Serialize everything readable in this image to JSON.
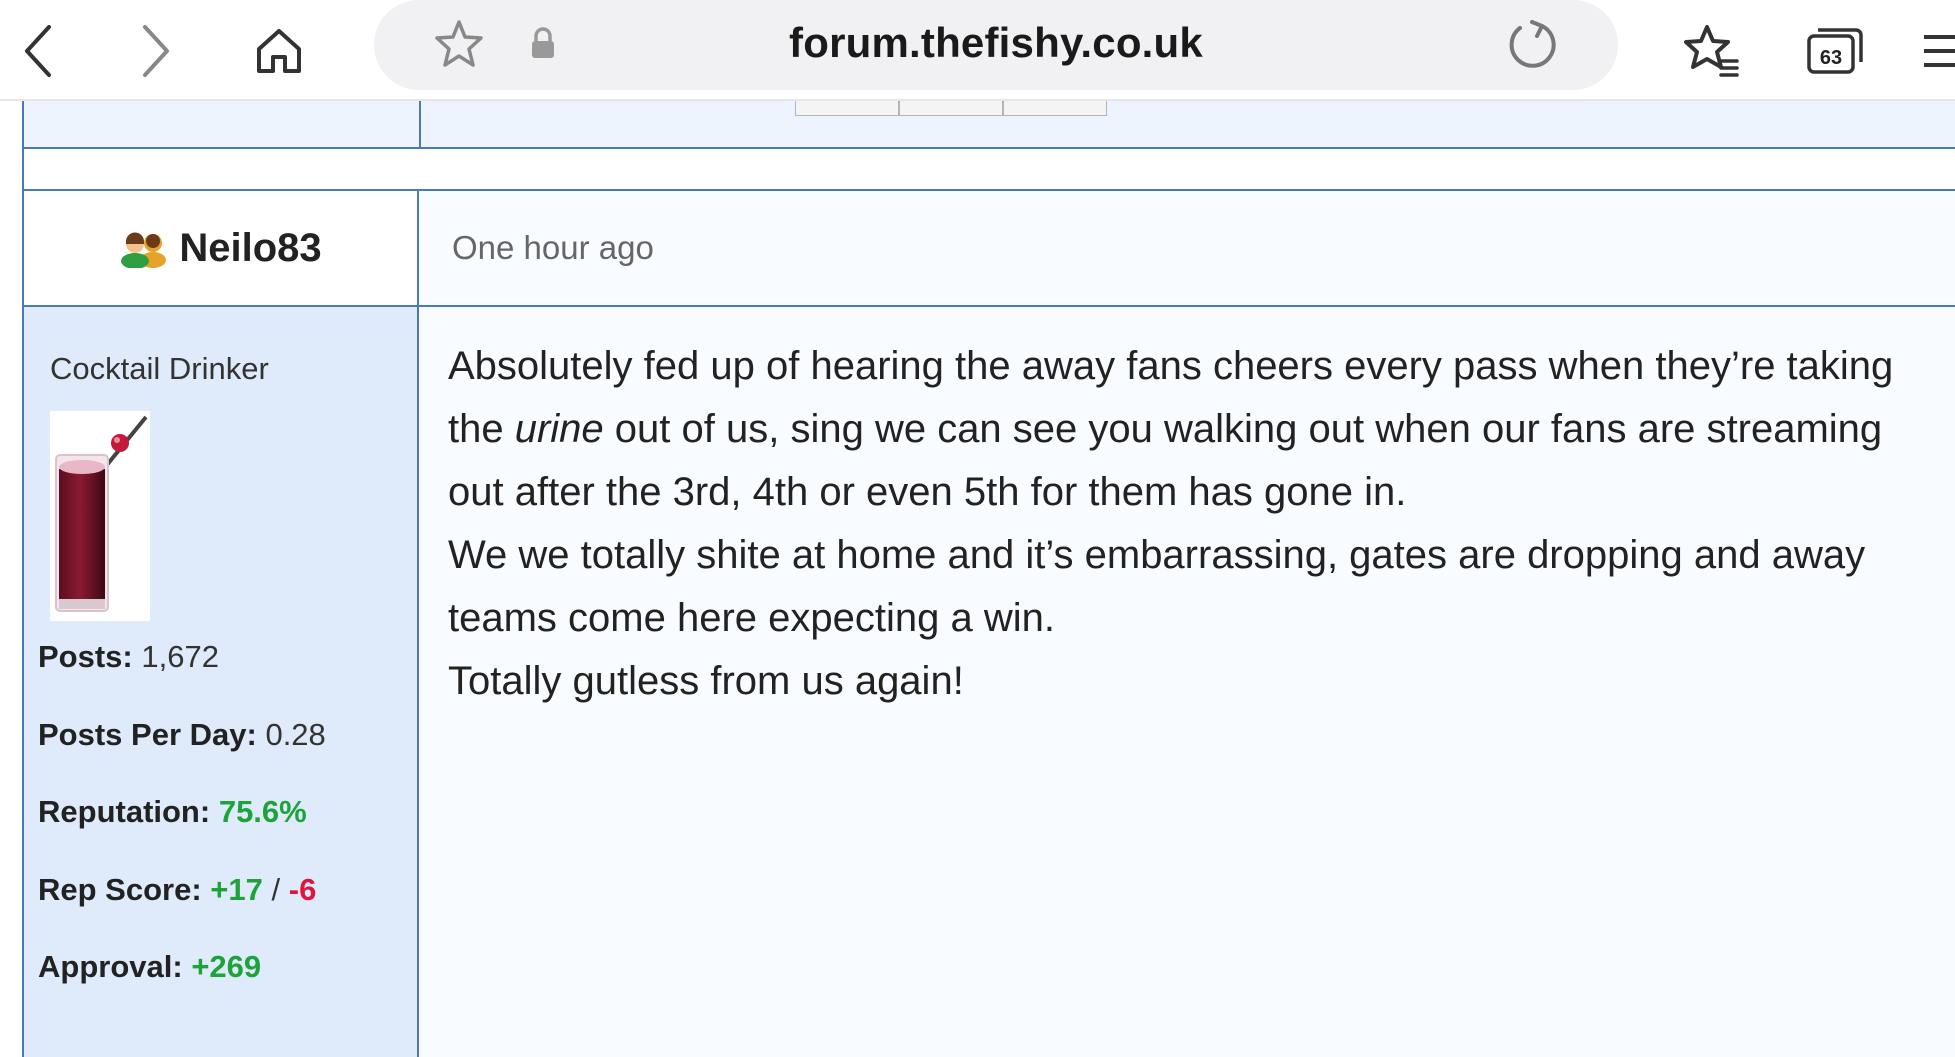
{
  "browser": {
    "url": "forum.thefishy.co.uk",
    "tab_count": "63",
    "icons": {
      "back": "chevron-left-icon",
      "forward": "chevron-right-icon",
      "home": "home-icon",
      "bookmark": "star-icon",
      "secure": "lock-icon",
      "reload": "reload-icon",
      "bookmarks_list": "bookmarks-icon",
      "tabs": "tabs-icon",
      "menu": "menu-icon"
    }
  },
  "post": {
    "username": "Neilo83",
    "time": "One hour ago",
    "rank": "Cocktail Drinker",
    "stats": {
      "posts_label": "Posts:",
      "posts_value": "1,672",
      "ppd_label": "Posts Per Day:",
      "ppd_value": "0.28",
      "reputation_label": "Reputation:",
      "reputation_value": "75.6%",
      "repscore_label": "Rep Score:",
      "repscore_pos": "+17",
      "repscore_sep": "/",
      "repscore_neg": "-6",
      "approval_label": "Approval:",
      "approval_value": "+269"
    },
    "body": {
      "p1_before": "Absolutely fed up of hearing the away fans cheers every pass when they’re taking the ",
      "p1_em": "urine",
      "p1_after": " out of us, sing we can see you walking out when our fans are streaming out after the 3rd, 4th or even 5th for them has gone in.",
      "p2": "We we totally shite at home and it’s embarrassing, gates are dropping and away teams come here expecting a win.",
      "p3": "Totally gutless from us again!"
    }
  },
  "colors": {
    "border": "#4a7ab8",
    "sidebar_bg": "#dfeafb",
    "positive": "#1ca33a",
    "negative": "#e0143c"
  }
}
